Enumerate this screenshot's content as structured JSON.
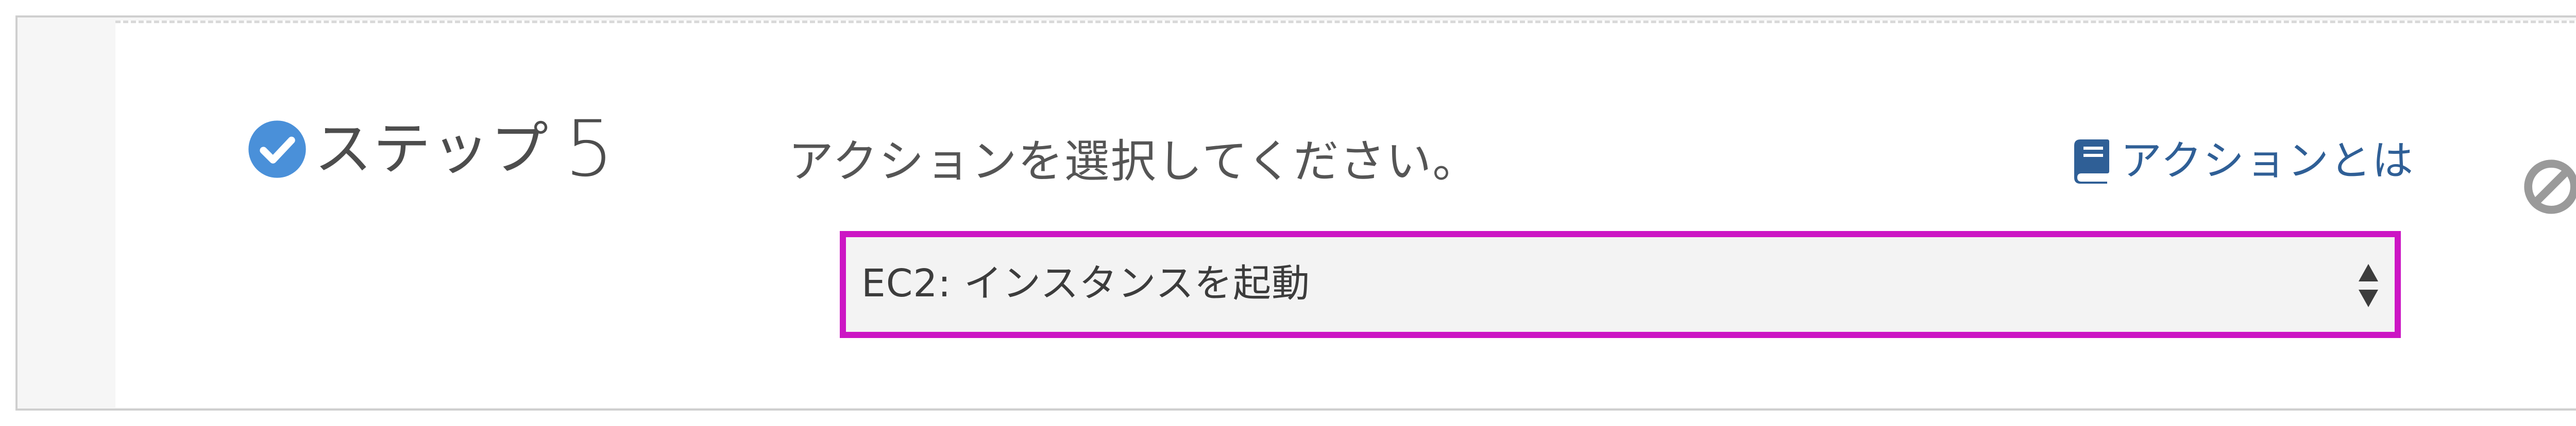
{
  "step": {
    "label": "ステップ",
    "number": "5",
    "status_icon": "check-circle-icon"
  },
  "action": {
    "prompt": "アクションを選択してください。",
    "help_link": {
      "label": "アクションとは",
      "icon": "book-icon"
    },
    "disable_icon": "ban-icon",
    "select": {
      "value": "EC2: インスタンスを起動",
      "icon": "sort-arrows-icon"
    }
  },
  "colors": {
    "accent_blue": "#4a90d9",
    "link_blue": "#2f5f96",
    "highlight_magenta": "#cc16c4",
    "text_gray": "#555555",
    "icon_gray": "#9a9a9a"
  }
}
